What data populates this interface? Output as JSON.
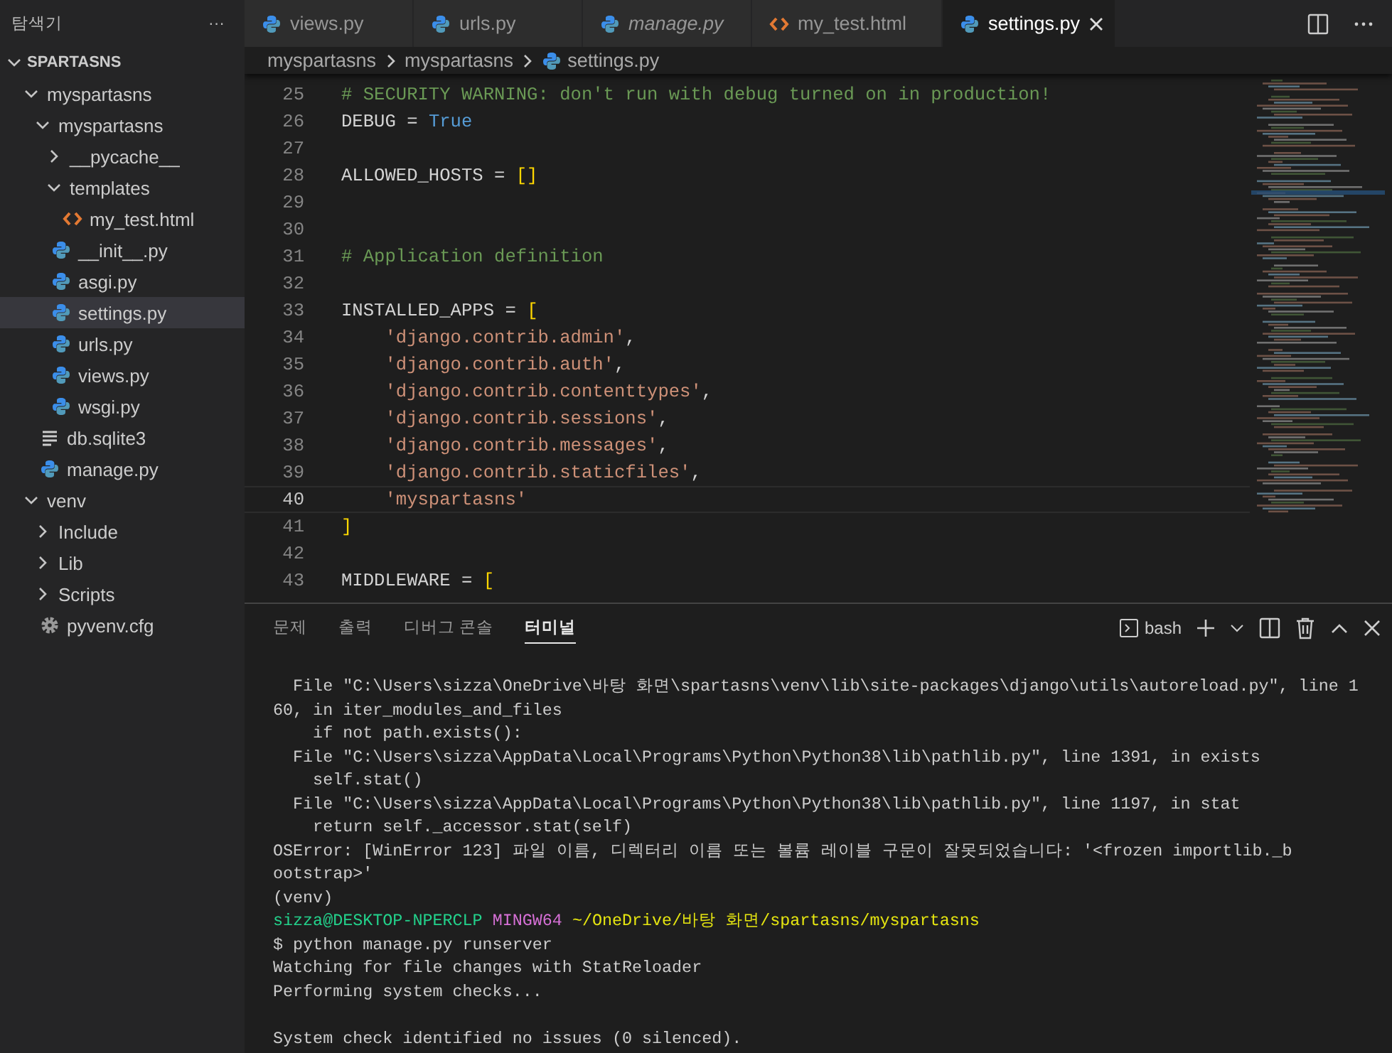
{
  "sidebar": {
    "title": "탐색기",
    "more": "···",
    "section": {
      "label": "SPARTASNS",
      "expanded": true
    },
    "tree": [
      {
        "label": "myspartasns",
        "kind": "folder",
        "expanded": true,
        "selected": false,
        "children": [
          {
            "label": "myspartasns",
            "kind": "folder",
            "expanded": true,
            "selected": false,
            "children": [
              {
                "label": "__pycache__",
                "kind": "folder",
                "expanded": false,
                "selected": false
              },
              {
                "label": "templates",
                "kind": "folder",
                "expanded": true,
                "selected": false,
                "children": [
                  {
                    "label": "my_test.html",
                    "kind": "html",
                    "selected": false
                  }
                ]
              },
              {
                "label": "__init__.py",
                "kind": "python",
                "selected": false
              },
              {
                "label": "asgi.py",
                "kind": "python",
                "selected": false
              },
              {
                "label": "settings.py",
                "kind": "python",
                "selected": true
              },
              {
                "label": "urls.py",
                "kind": "python",
                "selected": false
              },
              {
                "label": "views.py",
                "kind": "python",
                "selected": false
              },
              {
                "label": "wsgi.py",
                "kind": "python",
                "selected": false
              }
            ]
          },
          {
            "label": "db.sqlite3",
            "kind": "data",
            "selected": false
          },
          {
            "label": "manage.py",
            "kind": "python",
            "selected": false
          }
        ]
      },
      {
        "label": "venv",
        "kind": "folder",
        "expanded": true,
        "selected": false,
        "children": [
          {
            "label": "Include",
            "kind": "folder",
            "expanded": false,
            "selected": false
          },
          {
            "label": "Lib",
            "kind": "folder",
            "expanded": false,
            "selected": false
          },
          {
            "label": "Scripts",
            "kind": "folder",
            "expanded": false,
            "selected": false
          },
          {
            "label": "pyvenv.cfg",
            "kind": "config",
            "selected": false
          }
        ]
      }
    ]
  },
  "tabs": [
    {
      "label": "views.py",
      "kind": "python",
      "selected": false,
      "preview": false
    },
    {
      "label": "urls.py",
      "kind": "python",
      "selected": false,
      "preview": false
    },
    {
      "label": "manage.py",
      "kind": "python",
      "selected": false,
      "preview": true
    },
    {
      "label": "my_test.html",
      "kind": "html",
      "selected": false,
      "preview": false
    },
    {
      "label": "settings.py",
      "kind": "python",
      "selected": true,
      "preview": false
    }
  ],
  "breadcrumb": [
    {
      "label": "myspartasns",
      "kind": "folder"
    },
    {
      "label": "myspartasns",
      "kind": "folder"
    },
    {
      "label": "settings.py",
      "kind": "python"
    }
  ],
  "code": [
    {
      "number": "25",
      "current": false,
      "tokens": [
        {
          "kind": "comment",
          "text": "# SECURITY WARNING: don't run with debug turned on in production!"
        }
      ]
    },
    {
      "number": "26",
      "current": false,
      "tokens": [
        {
          "kind": "plain",
          "text": "DEBUG = "
        },
        {
          "kind": "constant",
          "text": "True"
        }
      ]
    },
    {
      "number": "27",
      "current": false
    },
    {
      "number": "28",
      "current": false,
      "tokens": [
        {
          "kind": "plain",
          "text": "ALLOWED_HOSTS = "
        },
        {
          "kind": "bracket",
          "text": "[]"
        }
      ]
    },
    {
      "number": "29",
      "current": false
    },
    {
      "number": "30",
      "current": false
    },
    {
      "number": "31",
      "current": false,
      "tokens": [
        {
          "kind": "comment",
          "text": "# Application definition"
        }
      ]
    },
    {
      "number": "32",
      "current": false
    },
    {
      "number": "33",
      "current": false,
      "tokens": [
        {
          "kind": "plain",
          "text": "INSTALLED_APPS = "
        },
        {
          "kind": "bracket",
          "text": "["
        }
      ]
    },
    {
      "number": "34",
      "current": false,
      "tokens": [
        {
          "kind": "string",
          "text": "    'django.contrib.admin'"
        },
        {
          "kind": "plain",
          "text": ","
        }
      ]
    },
    {
      "number": "35",
      "current": false,
      "tokens": [
        {
          "kind": "string",
          "text": "    'django.contrib.auth'"
        },
        {
          "kind": "plain",
          "text": ","
        }
      ]
    },
    {
      "number": "36",
      "current": false,
      "tokens": [
        {
          "kind": "string",
          "text": "    'django.contrib.contenttypes'"
        },
        {
          "kind": "plain",
          "text": ","
        }
      ]
    },
    {
      "number": "37",
      "current": false,
      "tokens": [
        {
          "kind": "string",
          "text": "    'django.contrib.sessions'"
        },
        {
          "kind": "plain",
          "text": ","
        }
      ]
    },
    {
      "number": "38",
      "current": false,
      "tokens": [
        {
          "kind": "string",
          "text": "    'django.contrib.messages'"
        },
        {
          "kind": "plain",
          "text": ","
        }
      ]
    },
    {
      "number": "39",
      "current": false,
      "tokens": [
        {
          "kind": "string",
          "text": "    'django.contrib.staticfiles'"
        },
        {
          "kind": "plain",
          "text": ","
        }
      ]
    },
    {
      "number": "40",
      "current": true,
      "tokens": [
        {
          "kind": "string",
          "text": "    'myspartasns'"
        }
      ]
    },
    {
      "number": "41",
      "current": false,
      "tokens": [
        {
          "kind": "bracket",
          "text": "]"
        }
      ]
    },
    {
      "number": "42",
      "current": false
    },
    {
      "number": "43",
      "current": false,
      "tokens": [
        {
          "kind": "plain",
          "text": "MIDDLEWARE = "
        },
        {
          "kind": "bracket",
          "text": "["
        }
      ]
    }
  ],
  "panel": {
    "tabs": [
      {
        "label": "문제",
        "selected": false
      },
      {
        "label": "출력",
        "selected": false
      },
      {
        "label": "디버그 콘솔",
        "selected": false
      },
      {
        "label": "터미널",
        "selected": true
      }
    ],
    "shell": "bash",
    "terminal": [
      {
        "kind": "text",
        "text": "  File \"C:\\Users\\sizza\\OneDrive\\바탕 화면\\spartasns\\venv\\lib\\site-packages\\django\\utils\\autoreload.py\", line 1"
      },
      {
        "kind": "text",
        "text": "60, in iter_modules_and_files"
      },
      {
        "kind": "text",
        "text": "    if not path.exists():"
      },
      {
        "kind": "text",
        "text": "  File \"C:\\Users\\sizza\\AppData\\Local\\Programs\\Python\\Python38\\lib\\pathlib.py\", line 1391, in exists"
      },
      {
        "kind": "text",
        "text": "    self.stat()"
      },
      {
        "kind": "text",
        "text": "  File \"C:\\Users\\sizza\\AppData\\Local\\Programs\\Python\\Python38\\lib\\pathlib.py\", line 1197, in stat"
      },
      {
        "kind": "text",
        "text": "    return self._accessor.stat(self)"
      },
      {
        "kind": "text",
        "text": "OSError: [WinError 123] 파일 이름, 디렉터리 이름 또는 볼륨 레이블 구문이 잘못되었습니다: '<frozen importlib._b"
      },
      {
        "kind": "text",
        "text": "ootstrap>'"
      },
      {
        "kind": "text",
        "text": "(venv)"
      },
      {
        "kind": "prompt",
        "user": "sizza@DESKTOP-NPERCLP",
        "system": "MINGW64",
        "path": "~/OneDrive/바탕 화면/spartasns/myspartasns"
      },
      {
        "kind": "text",
        "text": "$ python manage.py runserver"
      },
      {
        "kind": "text",
        "text": "Watching for file changes with StatReloader"
      },
      {
        "kind": "text",
        "text": "Performing system checks..."
      },
      {
        "kind": "blank"
      },
      {
        "kind": "text",
        "text": "System check identified no issues (0 silenced)."
      }
    ]
  }
}
